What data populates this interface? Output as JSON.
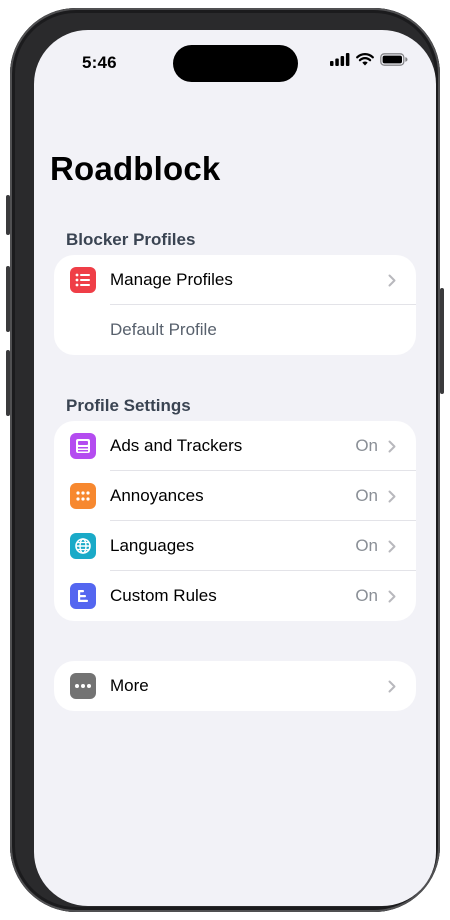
{
  "status_bar": {
    "time": "5:46",
    "icons": [
      "cellular-signal-icon",
      "wifi-icon",
      "battery-icon"
    ]
  },
  "page": {
    "title": "Roadblock"
  },
  "blocker_profiles": {
    "header": "Blocker Profiles",
    "items": [
      {
        "label": "Manage Profiles",
        "icon": "list-icon",
        "icon_color": "#ef3e47"
      },
      {
        "label": "Default Profile"
      }
    ]
  },
  "profile_settings": {
    "header": "Profile Settings",
    "items": [
      {
        "label": "Ads and Trackers",
        "value": "On",
        "icon": "ads-icon",
        "icon_color": "#b44cf0"
      },
      {
        "label": "Annoyances",
        "value": "On",
        "icon": "annoyances-grid-icon",
        "icon_color": "#f7882f"
      },
      {
        "label": "Languages",
        "value": "On",
        "icon": "globe-icon",
        "icon_color": "#1aaac8"
      },
      {
        "label": "Custom Rules",
        "value": "On",
        "icon": "custom-rules-icon",
        "icon_color": "#5466f0"
      }
    ]
  },
  "more_group": {
    "items": [
      {
        "label": "More",
        "icon": "ellipsis-icon",
        "icon_color": "#737373"
      }
    ]
  },
  "colors": {
    "background": "#f2f2f7",
    "card": "#ffffff",
    "section_header": "#3a4452",
    "secondary_text": "#8a8f96"
  }
}
